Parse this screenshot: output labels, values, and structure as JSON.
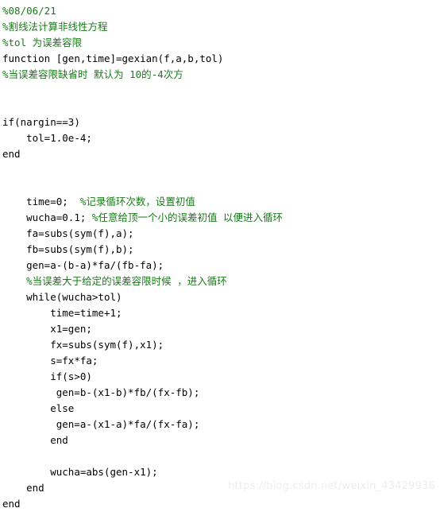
{
  "document": {
    "language": "MATLAB",
    "background_color": "#ffffff",
    "colors": {
      "keyword": "#0000ff",
      "comment": "#1a7a1a",
      "plain": "#000000",
      "watermark": "#ededed"
    }
  },
  "watermark": {
    "text": "https://blog.csdn.net/weixin_43429936"
  },
  "code": {
    "lines": [
      {
        "id": 1,
        "indent": 0,
        "tokens": [
          {
            "type": "comment",
            "text": "%08/06/21"
          }
        ]
      },
      {
        "id": 2,
        "indent": 0,
        "tokens": [
          {
            "type": "comment",
            "text": "%割线法计算非线性方程"
          }
        ]
      },
      {
        "id": 3,
        "indent": 0,
        "tokens": [
          {
            "type": "comment",
            "text": "%tol 为误差容限"
          }
        ]
      },
      {
        "id": 4,
        "indent": 0,
        "tokens": [
          {
            "type": "keyword",
            "text": "function"
          },
          {
            "type": "plain",
            "text": " [gen,time]=gexian(f,a,b,tol)"
          }
        ]
      },
      {
        "id": 5,
        "indent": 0,
        "tokens": [
          {
            "type": "comment",
            "text": "%当误差容限缺省时 默认为 10的-4次方"
          }
        ]
      },
      {
        "id": 6,
        "indent": 0,
        "tokens": []
      },
      {
        "id": 7,
        "indent": 0,
        "tokens": []
      },
      {
        "id": 8,
        "indent": 0,
        "tokens": [
          {
            "type": "keyword",
            "text": "if"
          },
          {
            "type": "plain",
            "text": "(nargin==3)"
          }
        ]
      },
      {
        "id": 9,
        "indent": 4,
        "tokens": [
          {
            "type": "plain",
            "text": "tol=1.0e-4;"
          }
        ]
      },
      {
        "id": 10,
        "indent": 0,
        "tokens": [
          {
            "type": "keyword",
            "text": "end"
          }
        ]
      },
      {
        "id": 11,
        "indent": 0,
        "tokens": []
      },
      {
        "id": 12,
        "indent": 0,
        "tokens": []
      },
      {
        "id": 13,
        "indent": 4,
        "tokens": [
          {
            "type": "plain",
            "text": "time=0;  "
          },
          {
            "type": "comment",
            "text": "%记录循环次数，设置初值"
          }
        ]
      },
      {
        "id": 14,
        "indent": 4,
        "tokens": [
          {
            "type": "plain",
            "text": "wucha=0.1; "
          },
          {
            "type": "comment",
            "text": "%任意给顶一个小的误差初值 以便进入循环"
          }
        ]
      },
      {
        "id": 15,
        "indent": 4,
        "tokens": [
          {
            "type": "plain",
            "text": "fa=subs(sym(f),a);"
          }
        ]
      },
      {
        "id": 16,
        "indent": 4,
        "tokens": [
          {
            "type": "plain",
            "text": "fb=subs(sym(f),b);"
          }
        ]
      },
      {
        "id": 17,
        "indent": 4,
        "tokens": [
          {
            "type": "plain",
            "text": "gen=a-(b-a)*fa/(fb-fa);"
          }
        ]
      },
      {
        "id": 18,
        "indent": 4,
        "tokens": [
          {
            "type": "comment",
            "text": "%当误差大于给定的误差容限时候 ，进入循环"
          }
        ]
      },
      {
        "id": 19,
        "indent": 4,
        "tokens": [
          {
            "type": "keyword",
            "text": "while"
          },
          {
            "type": "plain",
            "text": "(wucha>tol)"
          }
        ]
      },
      {
        "id": 20,
        "indent": 8,
        "tokens": [
          {
            "type": "plain",
            "text": "time=time+1;"
          }
        ]
      },
      {
        "id": 21,
        "indent": 8,
        "tokens": [
          {
            "type": "plain",
            "text": "x1=gen;"
          }
        ]
      },
      {
        "id": 22,
        "indent": 8,
        "tokens": [
          {
            "type": "plain",
            "text": "fx=subs(sym(f),x1);"
          }
        ]
      },
      {
        "id": 23,
        "indent": 8,
        "tokens": [
          {
            "type": "plain",
            "text": "s=fx*fa;"
          }
        ]
      },
      {
        "id": 24,
        "indent": 8,
        "tokens": [
          {
            "type": "keyword",
            "text": "if"
          },
          {
            "type": "plain",
            "text": "(s>0)"
          }
        ]
      },
      {
        "id": 25,
        "indent": 9,
        "tokens": [
          {
            "type": "plain",
            "text": "gen=b-(x1-b)*fb/(fx-fb);"
          }
        ]
      },
      {
        "id": 26,
        "indent": 8,
        "tokens": [
          {
            "type": "keyword",
            "text": "else"
          }
        ]
      },
      {
        "id": 27,
        "indent": 9,
        "tokens": [
          {
            "type": "plain",
            "text": "gen=a-(x1-a)*fa/(fx-fa);"
          }
        ]
      },
      {
        "id": 28,
        "indent": 8,
        "tokens": [
          {
            "type": "keyword",
            "text": "end"
          }
        ]
      },
      {
        "id": 29,
        "indent": 0,
        "tokens": []
      },
      {
        "id": 30,
        "indent": 8,
        "tokens": [
          {
            "type": "plain",
            "text": "wucha=abs(gen-x1);"
          }
        ]
      },
      {
        "id": 31,
        "indent": 4,
        "tokens": [
          {
            "type": "keyword",
            "text": "end"
          }
        ]
      },
      {
        "id": 32,
        "indent": 0,
        "tokens": [
          {
            "type": "keyword",
            "text": "end"
          }
        ]
      }
    ]
  }
}
